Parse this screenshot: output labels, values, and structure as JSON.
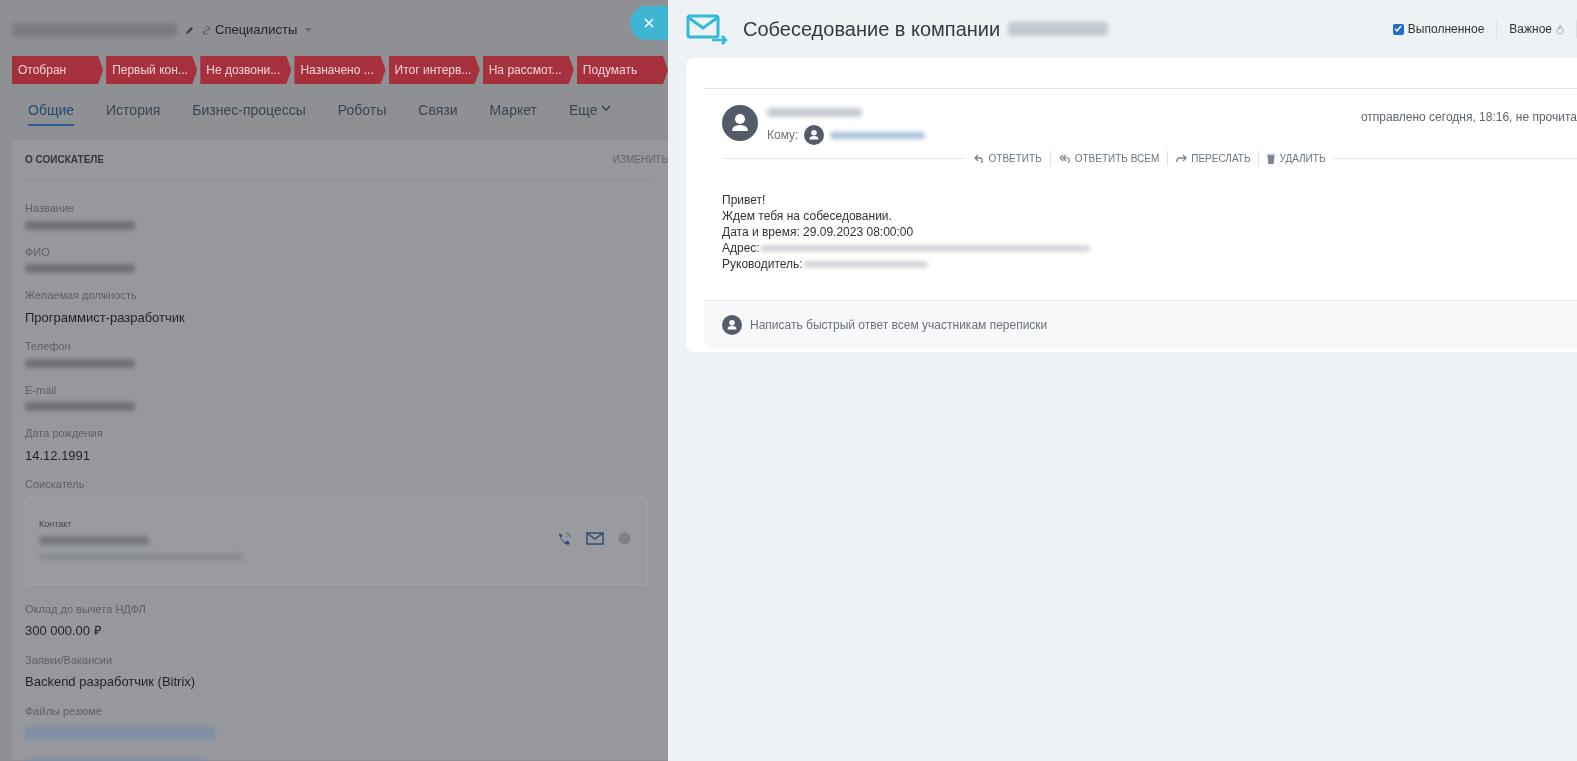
{
  "card_header": {
    "title_redacted": true,
    "category": "Специалисты"
  },
  "stages": [
    {
      "label": "Отобран"
    },
    {
      "label": "Первый кон..."
    },
    {
      "label": "Не дозвони..."
    },
    {
      "label": "Назначено ..."
    },
    {
      "label": "Итог интерв..."
    },
    {
      "label": "На рассмот..."
    },
    {
      "label": "Подумать"
    }
  ],
  "tabs": [
    {
      "label": "Общие",
      "selected": true
    },
    {
      "label": "История",
      "selected": false
    },
    {
      "label": "Бизнес-процессы",
      "selected": false
    },
    {
      "label": "Роботы",
      "selected": false
    },
    {
      "label": "Связи",
      "selected": false
    },
    {
      "label": "Маркет",
      "selected": false
    },
    {
      "label": "Еще",
      "selected": false,
      "dropdown": true
    }
  ],
  "section": {
    "title": "О СОИСКАТЕЛЕ",
    "action": "ИЗМЕНИТЬ",
    "fields": [
      {
        "kind": "text",
        "label": "Название",
        "redacted": true
      },
      {
        "kind": "text",
        "label": "ФИО",
        "redacted": true
      },
      {
        "kind": "text",
        "label": "Желаемая должность",
        "value": "Программист-разработчик"
      },
      {
        "kind": "text",
        "label": "Телефон",
        "redacted": true
      },
      {
        "kind": "text",
        "label": "E-mail",
        "redacted": true
      },
      {
        "kind": "text",
        "label": "Дата рождения",
        "value": "14.12.1991"
      },
      {
        "kind": "contact",
        "label": "Соискатель",
        "contact_label": "Контакт"
      },
      {
        "kind": "text",
        "label": "Оклад до вычета НДФЛ",
        "value": "300 000.00 ₽"
      },
      {
        "kind": "text",
        "label": "Заявки/Вакансии",
        "value": "Backend разработчик (Bitrix)"
      },
      {
        "kind": "files",
        "label": "Файлы резюме"
      }
    ]
  },
  "email": {
    "title": "Собеседование в компании",
    "title_redacted": true,
    "flags": [
      {
        "kind": "checkbox",
        "label": "Выполненное",
        "checked": true
      },
      {
        "kind": "important",
        "label": "Важное"
      }
    ],
    "to_label": "Кому:",
    "sent_info": "отправлено сегодня, 18:16, не прочита",
    "actions": [
      {
        "kind": "reply",
        "label": "ОТВЕТИТЬ"
      },
      {
        "kind": "reply_all",
        "label": "ОТВЕТИТЬ ВСЕМ"
      },
      {
        "kind": "forward",
        "label": "ПЕРЕСЛАТЬ"
      },
      {
        "kind": "delete",
        "label": "УДАЛИТЬ"
      }
    ],
    "body": [
      {
        "text": "Привет!",
        "redacted": false
      },
      {
        "text": "Ждем тебя на собеседовании.",
        "redacted": false
      },
      {
        "text": "Дата и время: 29.09.2023 08:00:00",
        "redacted": false
      },
      {
        "text": "Адрес:",
        "redacted": true
      },
      {
        "text": "Руководитель:",
        "redacted": true
      }
    ],
    "quick_reply_placeholder": "Написать быстрый ответ всем участникам переписки"
  }
}
